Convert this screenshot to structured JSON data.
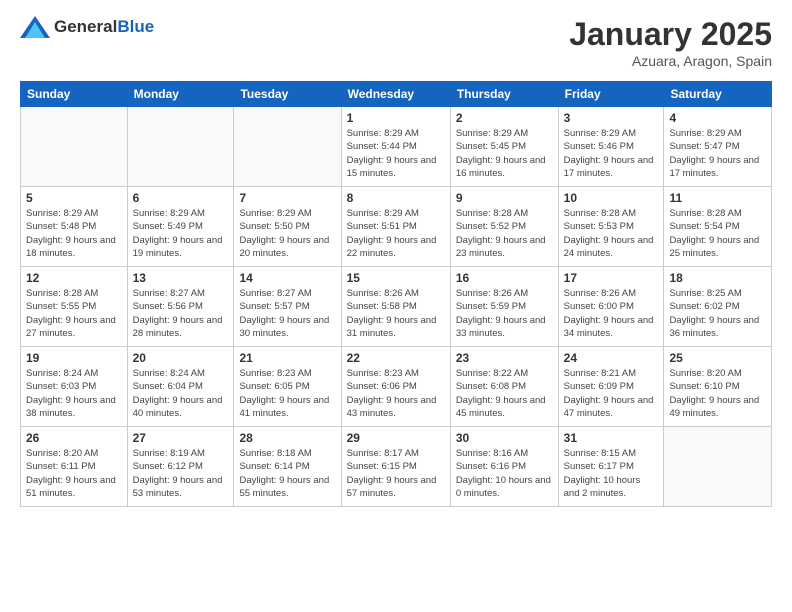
{
  "logo": {
    "text_general": "General",
    "text_blue": "Blue"
  },
  "header": {
    "month": "January 2025",
    "location": "Azuara, Aragon, Spain"
  },
  "weekdays": [
    "Sunday",
    "Monday",
    "Tuesday",
    "Wednesday",
    "Thursday",
    "Friday",
    "Saturday"
  ],
  "weeks": [
    [
      {
        "day": "",
        "sunrise": "",
        "sunset": "",
        "daylight": ""
      },
      {
        "day": "",
        "sunrise": "",
        "sunset": "",
        "daylight": ""
      },
      {
        "day": "",
        "sunrise": "",
        "sunset": "",
        "daylight": ""
      },
      {
        "day": "1",
        "sunrise": "Sunrise: 8:29 AM",
        "sunset": "Sunset: 5:44 PM",
        "daylight": "Daylight: 9 hours and 15 minutes."
      },
      {
        "day": "2",
        "sunrise": "Sunrise: 8:29 AM",
        "sunset": "Sunset: 5:45 PM",
        "daylight": "Daylight: 9 hours and 16 minutes."
      },
      {
        "day": "3",
        "sunrise": "Sunrise: 8:29 AM",
        "sunset": "Sunset: 5:46 PM",
        "daylight": "Daylight: 9 hours and 17 minutes."
      },
      {
        "day": "4",
        "sunrise": "Sunrise: 8:29 AM",
        "sunset": "Sunset: 5:47 PM",
        "daylight": "Daylight: 9 hours and 17 minutes."
      }
    ],
    [
      {
        "day": "5",
        "sunrise": "Sunrise: 8:29 AM",
        "sunset": "Sunset: 5:48 PM",
        "daylight": "Daylight: 9 hours and 18 minutes."
      },
      {
        "day": "6",
        "sunrise": "Sunrise: 8:29 AM",
        "sunset": "Sunset: 5:49 PM",
        "daylight": "Daylight: 9 hours and 19 minutes."
      },
      {
        "day": "7",
        "sunrise": "Sunrise: 8:29 AM",
        "sunset": "Sunset: 5:50 PM",
        "daylight": "Daylight: 9 hours and 20 minutes."
      },
      {
        "day": "8",
        "sunrise": "Sunrise: 8:29 AM",
        "sunset": "Sunset: 5:51 PM",
        "daylight": "Daylight: 9 hours and 22 minutes."
      },
      {
        "day": "9",
        "sunrise": "Sunrise: 8:28 AM",
        "sunset": "Sunset: 5:52 PM",
        "daylight": "Daylight: 9 hours and 23 minutes."
      },
      {
        "day": "10",
        "sunrise": "Sunrise: 8:28 AM",
        "sunset": "Sunset: 5:53 PM",
        "daylight": "Daylight: 9 hours and 24 minutes."
      },
      {
        "day": "11",
        "sunrise": "Sunrise: 8:28 AM",
        "sunset": "Sunset: 5:54 PM",
        "daylight": "Daylight: 9 hours and 25 minutes."
      }
    ],
    [
      {
        "day": "12",
        "sunrise": "Sunrise: 8:28 AM",
        "sunset": "Sunset: 5:55 PM",
        "daylight": "Daylight: 9 hours and 27 minutes."
      },
      {
        "day": "13",
        "sunrise": "Sunrise: 8:27 AM",
        "sunset": "Sunset: 5:56 PM",
        "daylight": "Daylight: 9 hours and 28 minutes."
      },
      {
        "day": "14",
        "sunrise": "Sunrise: 8:27 AM",
        "sunset": "Sunset: 5:57 PM",
        "daylight": "Daylight: 9 hours and 30 minutes."
      },
      {
        "day": "15",
        "sunrise": "Sunrise: 8:26 AM",
        "sunset": "Sunset: 5:58 PM",
        "daylight": "Daylight: 9 hours and 31 minutes."
      },
      {
        "day": "16",
        "sunrise": "Sunrise: 8:26 AM",
        "sunset": "Sunset: 5:59 PM",
        "daylight": "Daylight: 9 hours and 33 minutes."
      },
      {
        "day": "17",
        "sunrise": "Sunrise: 8:26 AM",
        "sunset": "Sunset: 6:00 PM",
        "daylight": "Daylight: 9 hours and 34 minutes."
      },
      {
        "day": "18",
        "sunrise": "Sunrise: 8:25 AM",
        "sunset": "Sunset: 6:02 PM",
        "daylight": "Daylight: 9 hours and 36 minutes."
      }
    ],
    [
      {
        "day": "19",
        "sunrise": "Sunrise: 8:24 AM",
        "sunset": "Sunset: 6:03 PM",
        "daylight": "Daylight: 9 hours and 38 minutes."
      },
      {
        "day": "20",
        "sunrise": "Sunrise: 8:24 AM",
        "sunset": "Sunset: 6:04 PM",
        "daylight": "Daylight: 9 hours and 40 minutes."
      },
      {
        "day": "21",
        "sunrise": "Sunrise: 8:23 AM",
        "sunset": "Sunset: 6:05 PM",
        "daylight": "Daylight: 9 hours and 41 minutes."
      },
      {
        "day": "22",
        "sunrise": "Sunrise: 8:23 AM",
        "sunset": "Sunset: 6:06 PM",
        "daylight": "Daylight: 9 hours and 43 minutes."
      },
      {
        "day": "23",
        "sunrise": "Sunrise: 8:22 AM",
        "sunset": "Sunset: 6:08 PM",
        "daylight": "Daylight: 9 hours and 45 minutes."
      },
      {
        "day": "24",
        "sunrise": "Sunrise: 8:21 AM",
        "sunset": "Sunset: 6:09 PM",
        "daylight": "Daylight: 9 hours and 47 minutes."
      },
      {
        "day": "25",
        "sunrise": "Sunrise: 8:20 AM",
        "sunset": "Sunset: 6:10 PM",
        "daylight": "Daylight: 9 hours and 49 minutes."
      }
    ],
    [
      {
        "day": "26",
        "sunrise": "Sunrise: 8:20 AM",
        "sunset": "Sunset: 6:11 PM",
        "daylight": "Daylight: 9 hours and 51 minutes."
      },
      {
        "day": "27",
        "sunrise": "Sunrise: 8:19 AM",
        "sunset": "Sunset: 6:12 PM",
        "daylight": "Daylight: 9 hours and 53 minutes."
      },
      {
        "day": "28",
        "sunrise": "Sunrise: 8:18 AM",
        "sunset": "Sunset: 6:14 PM",
        "daylight": "Daylight: 9 hours and 55 minutes."
      },
      {
        "day": "29",
        "sunrise": "Sunrise: 8:17 AM",
        "sunset": "Sunset: 6:15 PM",
        "daylight": "Daylight: 9 hours and 57 minutes."
      },
      {
        "day": "30",
        "sunrise": "Sunrise: 8:16 AM",
        "sunset": "Sunset: 6:16 PM",
        "daylight": "Daylight: 10 hours and 0 minutes."
      },
      {
        "day": "31",
        "sunrise": "Sunrise: 8:15 AM",
        "sunset": "Sunset: 6:17 PM",
        "daylight": "Daylight: 10 hours and 2 minutes."
      },
      {
        "day": "",
        "sunrise": "",
        "sunset": "",
        "daylight": ""
      }
    ]
  ]
}
